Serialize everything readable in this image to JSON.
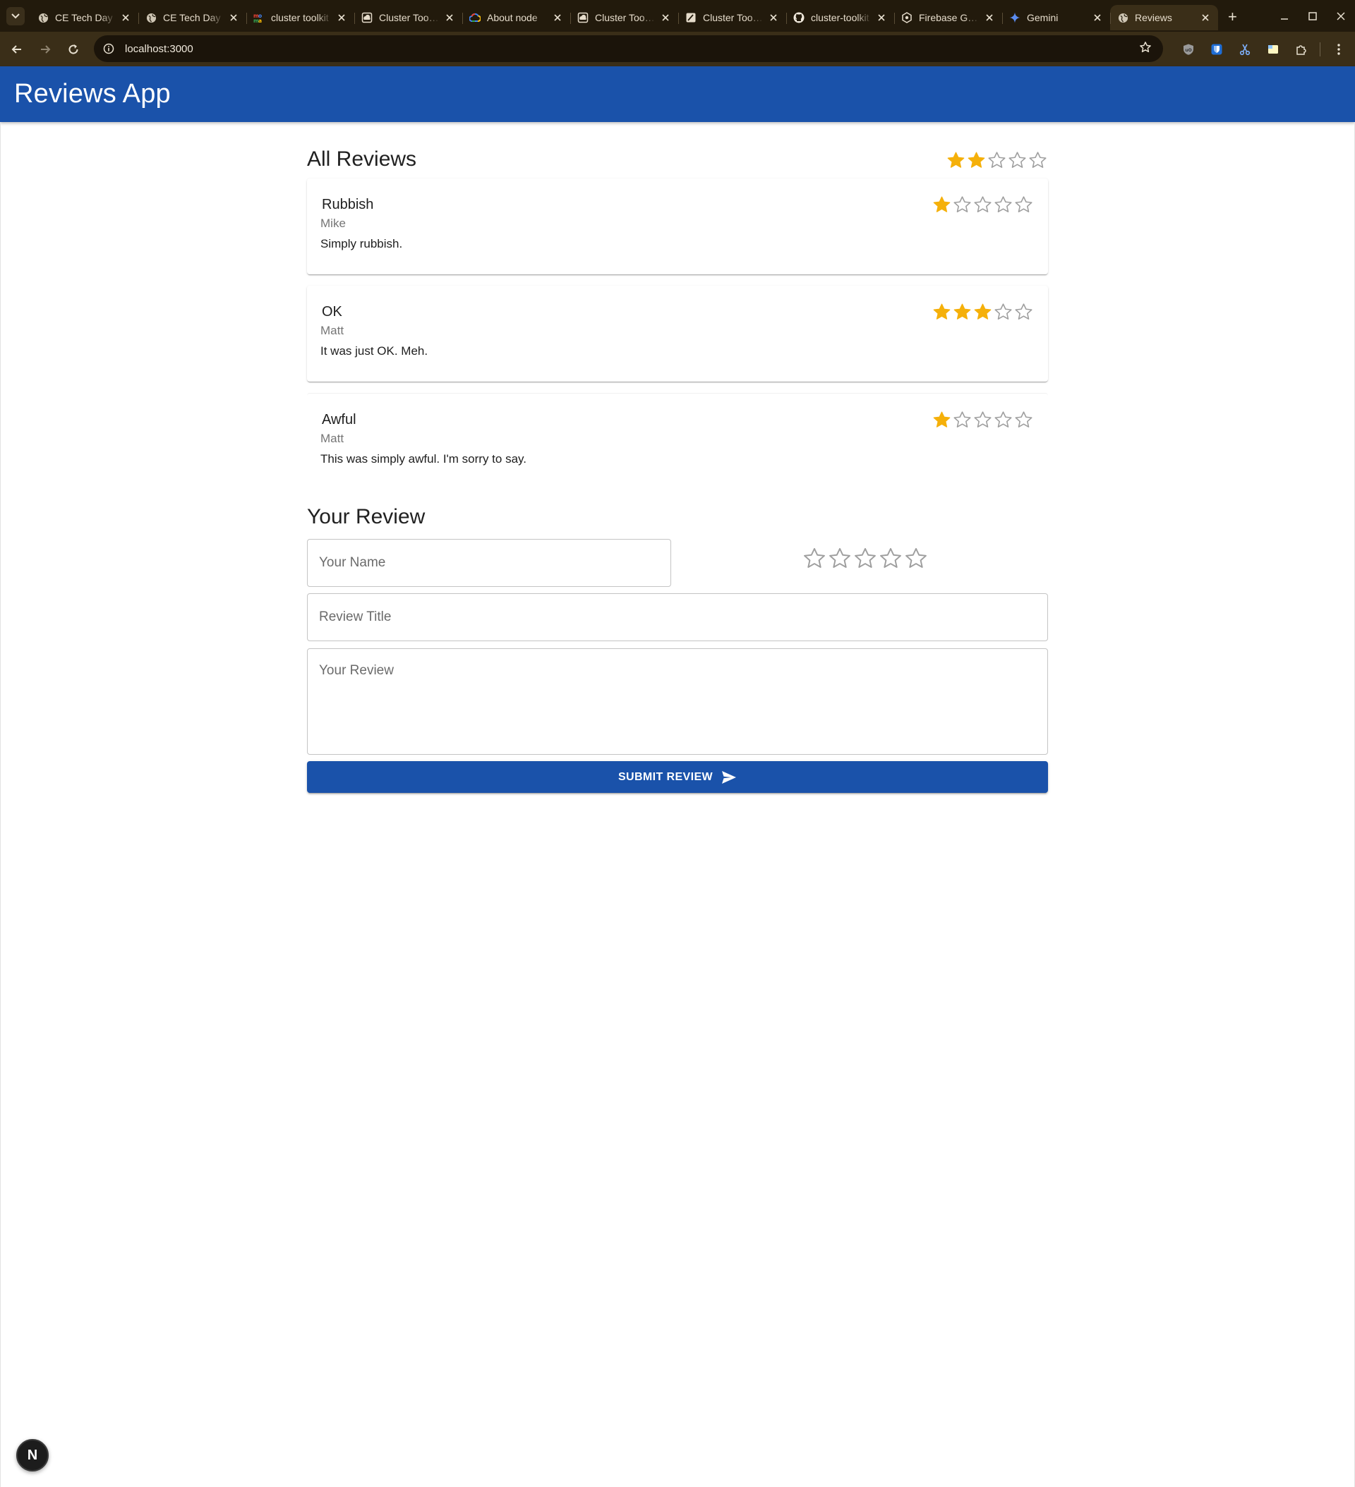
{
  "browser": {
    "tabs": [
      {
        "title": "CE Tech Day",
        "icon": "globe-icon",
        "active": false
      },
      {
        "title": "CE Tech Day",
        "icon": "globe-icon",
        "active": false
      },
      {
        "title": "cluster toolkit",
        "icon": "moma-icon",
        "active": false
      },
      {
        "title": "Cluster Toolkit",
        "icon": "cloud-doc-icon",
        "active": false
      },
      {
        "title": "About node",
        "icon": "google-cloud-icon",
        "active": false
      },
      {
        "title": "Cluster Toolkit",
        "icon": "cloud-doc-icon",
        "active": false
      },
      {
        "title": "Cluster Toolkit",
        "icon": "edit-doc-icon",
        "active": false
      },
      {
        "title": "cluster-toolkit",
        "icon": "github-icon",
        "active": false
      },
      {
        "title": "Firebase Genkit",
        "icon": "firebase-hex-icon",
        "active": false
      },
      {
        "title": "Gemini",
        "icon": "gemini-sparkle-icon",
        "active": false
      },
      {
        "title": "Reviews",
        "icon": "globe-icon",
        "active": true
      }
    ],
    "address": "localhost:3000",
    "colors": {
      "frame": "#221a0c",
      "toolbar": "#3a2e18",
      "omnibox": "#1b140a"
    }
  },
  "app": {
    "title": "Reviews App",
    "colors": {
      "primary": "#1a52aa",
      "star_filled": "#f5b00a",
      "star_empty": "#9e9e9e"
    }
  },
  "all_reviews": {
    "heading": "All Reviews",
    "average_rating": 2,
    "max_rating": 5
  },
  "reviews": [
    {
      "title": "Rubbish",
      "author": "Mike",
      "text": "Simply rubbish.",
      "rating": 1
    },
    {
      "title": "OK",
      "author": "Matt",
      "text": "It was just OK. Meh.",
      "rating": 3
    },
    {
      "title": "Awful",
      "author": "Matt",
      "text": "This was simply awful. I'm sorry to say.",
      "rating": 1
    }
  ],
  "form": {
    "heading": "Your Review",
    "name_placeholder": "Your Name",
    "title_placeholder": "Review Title",
    "review_placeholder": "Your Review",
    "rating": 0,
    "submit_label": "Submit Review",
    "submit_icon": "send-icon"
  },
  "dev_badge": {
    "label": "N",
    "icon": "nextjs-icon"
  }
}
